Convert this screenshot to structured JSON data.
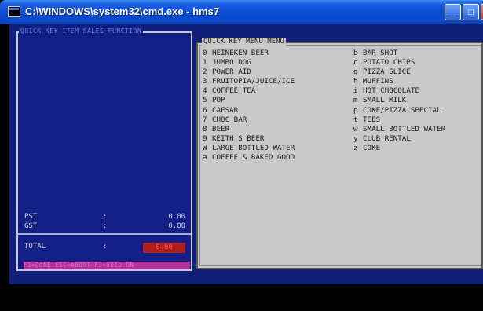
{
  "window": {
    "title": "C:\\WINDOWS\\system32\\cmd.exe - hms7",
    "min_label": "_",
    "max_label": "□",
    "close_label": "×"
  },
  "left_panel": {
    "title": "QUICK KEY ITEM SALES FUNCTION",
    "pst_label": "PST",
    "pst_colon": ":",
    "pst_value": "0.00",
    "gst_label": "GST",
    "gst_colon": ":",
    "gst_value": "0.00",
    "total_label": "TOTAL",
    "total_colon": ":",
    "total_value": "0.00",
    "status_text": "F1=DONE ESC=ABORT F3=VOID ON"
  },
  "right_panel": {
    "title": "QUICK KEY MENU MENU",
    "left_items": [
      {
        "key": "0",
        "label": "HEINEKEN BEER"
      },
      {
        "key": "1",
        "label": "JUMBO DOG"
      },
      {
        "key": "2",
        "label": "POWER AID"
      },
      {
        "key": "3",
        "label": "FRUITOPIA/JUICE/ICE"
      },
      {
        "key": "4",
        "label": "COFFEE TEA"
      },
      {
        "key": "5",
        "label": "POP"
      },
      {
        "key": "6",
        "label": "CAESAR"
      },
      {
        "key": "7",
        "label": "CHOC BAR"
      },
      {
        "key": "8",
        "label": "BEER"
      },
      {
        "key": "9",
        "label": "KEITH'S BEER"
      },
      {
        "key": "W",
        "label": "LARGE BOTTLED WATER"
      },
      {
        "key": "a",
        "label": "COFFEE & BAKED GOOD"
      }
    ],
    "right_items": [
      {
        "key": "b",
        "label": "BAR SHOT"
      },
      {
        "key": "c",
        "label": "POTATO CHIPS"
      },
      {
        "key": "g",
        "label": "PIZZA SLICE"
      },
      {
        "key": "h",
        "label": "MUFFINS"
      },
      {
        "key": "i",
        "label": "HOT CHOCOLATE"
      },
      {
        "key": "m",
        "label": "SMALL MILK"
      },
      {
        "key": "p",
        "label": "COKE/PIZZA SPECIAL"
      },
      {
        "key": "t",
        "label": "TEES"
      },
      {
        "key": "w",
        "label": "SMALL BOTTLED WATER"
      },
      {
        "key": "y",
        "label": "CLUB RENTAL"
      },
      {
        "key": "z",
        "label": "COKE"
      }
    ]
  }
}
